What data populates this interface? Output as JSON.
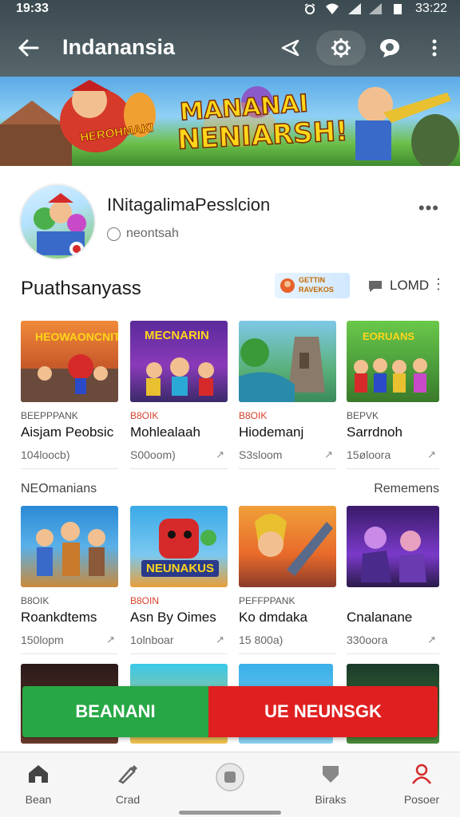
{
  "status_bar": {
    "time": "19:33",
    "time_right": "33:22"
  },
  "app_bar": {
    "title": "Indanansia"
  },
  "banner": {
    "headline_1": "MANANAI",
    "headline_2": "NENIARSH!",
    "logo_text": "HEROHMAKI"
  },
  "profile": {
    "name": "INitagalimaPesslcion",
    "handle": "neontsah"
  },
  "section": {
    "title": "Puathsanyass",
    "sponsor_text": "GETTIN RAVEKOS",
    "load_label": "LOMD"
  },
  "row1": [
    {
      "tag": "BEEPPPANK",
      "tag_color": "gray",
      "title": "Aisjam Peobsic",
      "meta": "104loocb)",
      "thumb": "a"
    },
    {
      "tag": "B8OIK",
      "tag_color": "red",
      "title": "Mohlealaah",
      "meta": "S00oom)",
      "thumb": "b"
    },
    {
      "tag": "B8OIK",
      "tag_color": "red",
      "title": "Hiodemanj",
      "meta": "S3sloom",
      "thumb": "c"
    },
    {
      "tag": "BEPVK",
      "tag_color": "gray",
      "title": "Sarrdnoh",
      "meta": "15øloora",
      "thumb": "d"
    }
  ],
  "subheads": {
    "left": "NEOmanians",
    "right": "Rememens"
  },
  "row2": [
    {
      "tag": "B8OIK",
      "tag_color": "gray",
      "title": "Roankdtems",
      "meta": "150lopm",
      "thumb": "e"
    },
    {
      "tag": "B8OIN",
      "tag_color": "red",
      "title": "Asn By Oimes",
      "meta": "1olnboar",
      "thumb": "f"
    },
    {
      "tag": "PEFFPPANK",
      "tag_color": "gray",
      "title": "Ko dmdaka",
      "meta": "15 800a)",
      "thumb": "g"
    },
    {
      "tag": "",
      "tag_color": "gray",
      "title": "Cnalanane",
      "meta": "330oora",
      "thumb": "h"
    }
  ],
  "thumb_text": {
    "a": "HEOWAONCNIT",
    "b": "MECNARIN",
    "d": "EORUANS",
    "f": "NEUNAKUS"
  },
  "actions": {
    "primary": "BEANANI",
    "secondary": "UE NEUNSGK"
  },
  "bottom_nav": [
    {
      "label": "Bean",
      "icon": "home-icon"
    },
    {
      "label": "Crad",
      "icon": "brush-icon"
    },
    {
      "label": "",
      "icon": "record-icon"
    },
    {
      "label": "Biraks",
      "icon": "shield-icon"
    },
    {
      "label": "Posoer",
      "icon": "person-icon"
    }
  ],
  "colors": {
    "accent_green": "#28a745",
    "accent_red": "#e02020",
    "appbar": "#4a5a60"
  }
}
